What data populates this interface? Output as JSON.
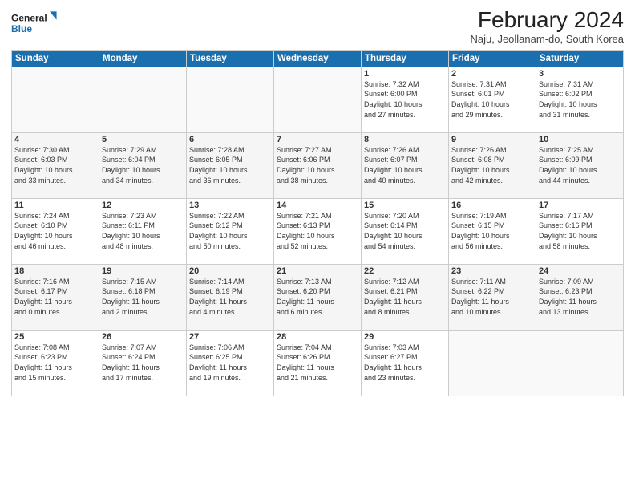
{
  "logo": {
    "line1": "General",
    "line2": "Blue"
  },
  "header": {
    "title": "February 2024",
    "subtitle": "Naju, Jeollanam-do, South Korea"
  },
  "weekdays": [
    "Sunday",
    "Monday",
    "Tuesday",
    "Wednesday",
    "Thursday",
    "Friday",
    "Saturday"
  ],
  "weeks": [
    [
      {
        "day": "",
        "info": ""
      },
      {
        "day": "",
        "info": ""
      },
      {
        "day": "",
        "info": ""
      },
      {
        "day": "",
        "info": ""
      },
      {
        "day": "1",
        "info": "Sunrise: 7:32 AM\nSunset: 6:00 PM\nDaylight: 10 hours\nand 27 minutes."
      },
      {
        "day": "2",
        "info": "Sunrise: 7:31 AM\nSunset: 6:01 PM\nDaylight: 10 hours\nand 29 minutes."
      },
      {
        "day": "3",
        "info": "Sunrise: 7:31 AM\nSunset: 6:02 PM\nDaylight: 10 hours\nand 31 minutes."
      }
    ],
    [
      {
        "day": "4",
        "info": "Sunrise: 7:30 AM\nSunset: 6:03 PM\nDaylight: 10 hours\nand 33 minutes."
      },
      {
        "day": "5",
        "info": "Sunrise: 7:29 AM\nSunset: 6:04 PM\nDaylight: 10 hours\nand 34 minutes."
      },
      {
        "day": "6",
        "info": "Sunrise: 7:28 AM\nSunset: 6:05 PM\nDaylight: 10 hours\nand 36 minutes."
      },
      {
        "day": "7",
        "info": "Sunrise: 7:27 AM\nSunset: 6:06 PM\nDaylight: 10 hours\nand 38 minutes."
      },
      {
        "day": "8",
        "info": "Sunrise: 7:26 AM\nSunset: 6:07 PM\nDaylight: 10 hours\nand 40 minutes."
      },
      {
        "day": "9",
        "info": "Sunrise: 7:26 AM\nSunset: 6:08 PM\nDaylight: 10 hours\nand 42 minutes."
      },
      {
        "day": "10",
        "info": "Sunrise: 7:25 AM\nSunset: 6:09 PM\nDaylight: 10 hours\nand 44 minutes."
      }
    ],
    [
      {
        "day": "11",
        "info": "Sunrise: 7:24 AM\nSunset: 6:10 PM\nDaylight: 10 hours\nand 46 minutes."
      },
      {
        "day": "12",
        "info": "Sunrise: 7:23 AM\nSunset: 6:11 PM\nDaylight: 10 hours\nand 48 minutes."
      },
      {
        "day": "13",
        "info": "Sunrise: 7:22 AM\nSunset: 6:12 PM\nDaylight: 10 hours\nand 50 minutes."
      },
      {
        "day": "14",
        "info": "Sunrise: 7:21 AM\nSunset: 6:13 PM\nDaylight: 10 hours\nand 52 minutes."
      },
      {
        "day": "15",
        "info": "Sunrise: 7:20 AM\nSunset: 6:14 PM\nDaylight: 10 hours\nand 54 minutes."
      },
      {
        "day": "16",
        "info": "Sunrise: 7:19 AM\nSunset: 6:15 PM\nDaylight: 10 hours\nand 56 minutes."
      },
      {
        "day": "17",
        "info": "Sunrise: 7:17 AM\nSunset: 6:16 PM\nDaylight: 10 hours\nand 58 minutes."
      }
    ],
    [
      {
        "day": "18",
        "info": "Sunrise: 7:16 AM\nSunset: 6:17 PM\nDaylight: 11 hours\nand 0 minutes."
      },
      {
        "day": "19",
        "info": "Sunrise: 7:15 AM\nSunset: 6:18 PM\nDaylight: 11 hours\nand 2 minutes."
      },
      {
        "day": "20",
        "info": "Sunrise: 7:14 AM\nSunset: 6:19 PM\nDaylight: 11 hours\nand 4 minutes."
      },
      {
        "day": "21",
        "info": "Sunrise: 7:13 AM\nSunset: 6:20 PM\nDaylight: 11 hours\nand 6 minutes."
      },
      {
        "day": "22",
        "info": "Sunrise: 7:12 AM\nSunset: 6:21 PM\nDaylight: 11 hours\nand 8 minutes."
      },
      {
        "day": "23",
        "info": "Sunrise: 7:11 AM\nSunset: 6:22 PM\nDaylight: 11 hours\nand 10 minutes."
      },
      {
        "day": "24",
        "info": "Sunrise: 7:09 AM\nSunset: 6:23 PM\nDaylight: 11 hours\nand 13 minutes."
      }
    ],
    [
      {
        "day": "25",
        "info": "Sunrise: 7:08 AM\nSunset: 6:23 PM\nDaylight: 11 hours\nand 15 minutes."
      },
      {
        "day": "26",
        "info": "Sunrise: 7:07 AM\nSunset: 6:24 PM\nDaylight: 11 hours\nand 17 minutes."
      },
      {
        "day": "27",
        "info": "Sunrise: 7:06 AM\nSunset: 6:25 PM\nDaylight: 11 hours\nand 19 minutes."
      },
      {
        "day": "28",
        "info": "Sunrise: 7:04 AM\nSunset: 6:26 PM\nDaylight: 11 hours\nand 21 minutes."
      },
      {
        "day": "29",
        "info": "Sunrise: 7:03 AM\nSunset: 6:27 PM\nDaylight: 11 hours\nand 23 minutes."
      },
      {
        "day": "",
        "info": ""
      },
      {
        "day": "",
        "info": ""
      }
    ]
  ],
  "colors": {
    "header_bg": "#1a6faf",
    "header_text": "#ffffff",
    "row_even": "#f5f5f5",
    "row_odd": "#ffffff"
  }
}
